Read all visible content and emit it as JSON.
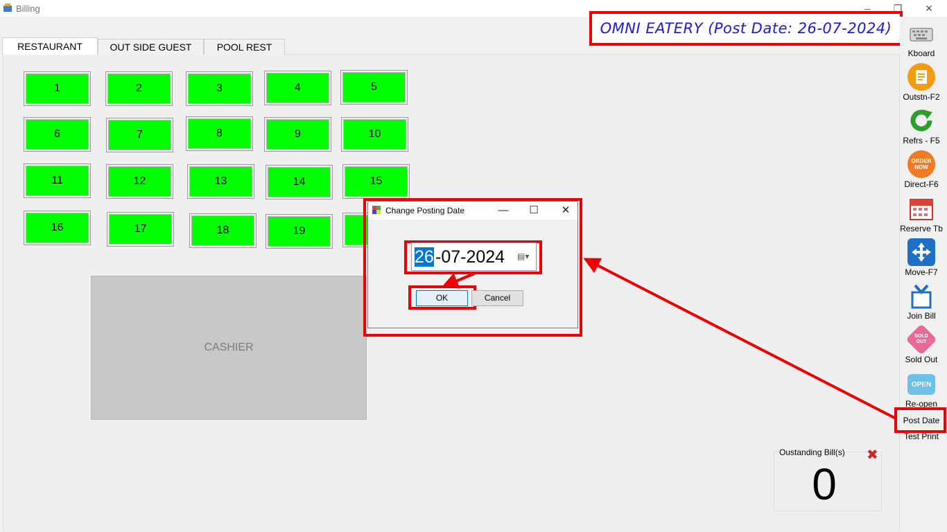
{
  "window": {
    "title": "Billing",
    "minimize": "–",
    "restore": "❐",
    "close": "✕"
  },
  "header": {
    "text": "OMNI EATERY (Post Date: 26-07-2024)"
  },
  "tabs": [
    "RESTAURANT",
    "OUT SIDE GUEST",
    "POOL REST"
  ],
  "tables": [
    "1",
    "2",
    "3",
    "4",
    "5",
    "6",
    "7",
    "8",
    "9",
    "10",
    "11",
    "12",
    "13",
    "14",
    "15",
    "16",
    "17",
    "18",
    "19"
  ],
  "cashier": "CASHIER",
  "toolbar": {
    "items": [
      "Kboard",
      "Outstn-F2",
      "Refrs - F5",
      "Direct-F6",
      "Reserve Tb",
      "Move-F7",
      "Join Bill",
      "Sold Out",
      "Re-open",
      "Post Date",
      "Test Print"
    ],
    "icons": [
      "keyboard-icon",
      "outstanding-icon",
      "refresh-icon",
      "order-now-icon",
      "calendar-icon",
      "move-icon",
      "join-bill-icon",
      "sold-out-icon",
      "open-sign-icon"
    ],
    "icon_text": {
      "direct": "ORDER NOW",
      "sold_out": "SOLD OUT",
      "reopen": "OPEN"
    }
  },
  "outstanding": {
    "label": "Oustanding Bill(s)",
    "count": "0"
  },
  "dialog": {
    "title": "Change Posting Date",
    "minimize": "—",
    "maximize": "☐",
    "close": "✕",
    "date_selected": "26",
    "date_rest": "-07-2024",
    "ok": "OK",
    "cancel": "Cancel"
  },
  "colors": {
    "table": "#00ff00",
    "highlight": "#ee0000",
    "header_text": "#1a1ad8",
    "cashier": "#c8c8c8"
  }
}
